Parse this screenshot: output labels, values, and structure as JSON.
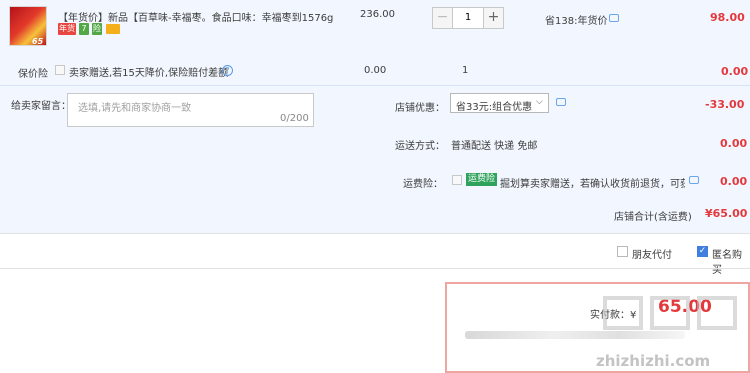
{
  "item": {
    "thumb_badge": "65",
    "title": "【年货价】新品【百草味-幸福枣。食品口味：幸福枣到1576g",
    "badges": [
      "年货",
      "7",
      "险"
    ],
    "unit_price": "236.00",
    "quantity": "1",
    "minus": "−",
    "plus": "+",
    "saved": "省138:年货价",
    "total": "98.00"
  },
  "insurance": {
    "label": "保价险",
    "text": "卖家赠送,若15天降价,保险赔付差额",
    "help": "?",
    "price": "0.00",
    "qty": "1",
    "total": "0.00"
  },
  "message": {
    "label": "给卖家留言：",
    "placeholder": "选填,请先和商家协商一致",
    "count": "0/200"
  },
  "discount": {
    "label": "店铺优惠：",
    "selected": "省33元:组合优惠",
    "chevron": "⌵",
    "value": "-33.00"
  },
  "shipping": {
    "label": "运送方式：",
    "text": "普通配送 快递 免邮",
    "value": "0.00"
  },
  "return_insurance": {
    "label": "运费险：",
    "badge": "运费险",
    "text": "掘划算卖家赠送，若确认收货前退货，可获保...",
    "value": "0.00"
  },
  "store_total": {
    "label": "店铺合计(含运费)",
    "value": "¥65.00"
  },
  "options": {
    "friend_pay": "朋友代付",
    "anonymous": "匿名购买",
    "anon_check": "✓"
  },
  "payment": {
    "label": "实付款：¥",
    "value": "65.00"
  },
  "watermark": "zhizhizhi.com",
  "colors": {
    "price_red": "#e4393c",
    "panel_bg": "#f2f7ff",
    "accent_blue": "#3e7fe0",
    "badge_green": "#2fa35b"
  }
}
